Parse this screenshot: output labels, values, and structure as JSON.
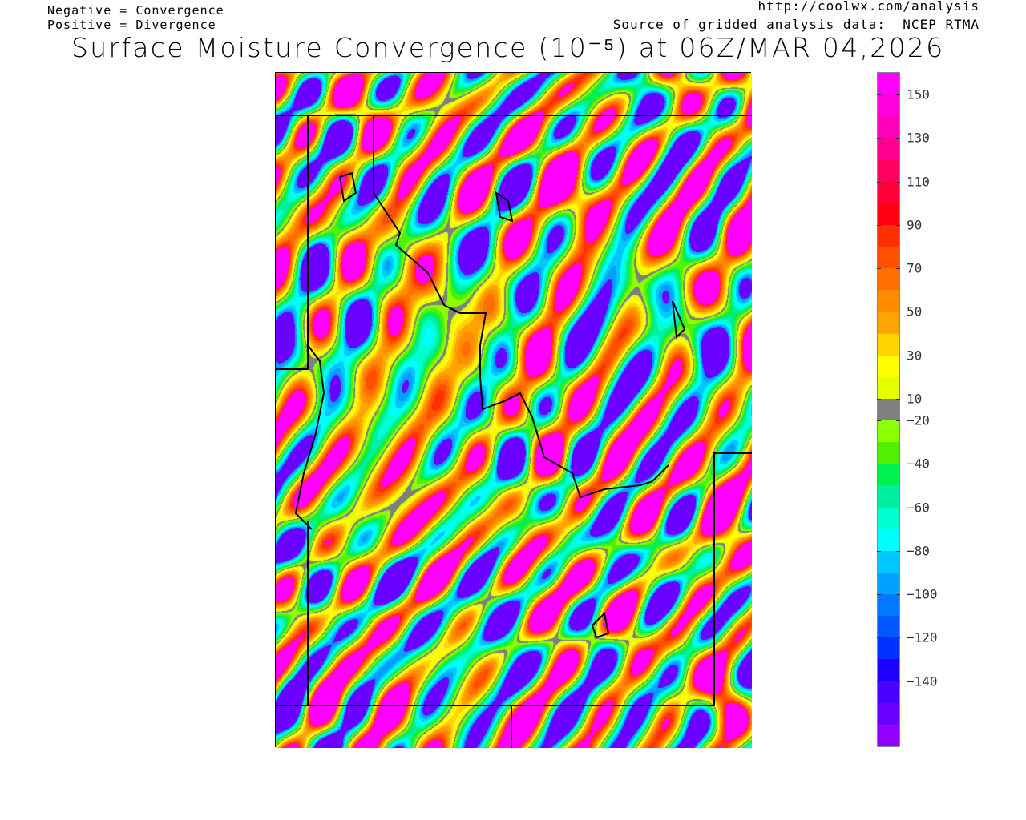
{
  "header": {
    "legend_negative": "Negative = Convergence",
    "legend_positive": "Positive = Divergence",
    "source_url": "http://coolwx.com/analysis",
    "source_data": "Source of gridded analysis data:  NCEP RTMA",
    "title": "Surface Moisture Convergence (10⁻⁵) at 06Z/MAR 04,2026"
  },
  "colorbar": {
    "tick_labels": [
      "150",
      "130",
      "110",
      "90",
      "70",
      "50",
      "30",
      "10",
      "−20",
      "−40",
      "−60",
      "−80",
      "−100",
      "−120",
      "−140"
    ],
    "colors": [
      "#ff00ff",
      "#ff00e0",
      "#ff00b8",
      "#ff0090",
      "#ff0060",
      "#ff0038",
      "#ff0010",
      "#ff3000",
      "#ff5000",
      "#ff7000",
      "#ff8c00",
      "#ffa400",
      "#ffd400",
      "#ffff00",
      "#e6ff00",
      "#7f7f7f",
      "#8cff00",
      "#50f000",
      "#00f050",
      "#00eea0",
      "#00ffd4",
      "#00ffff",
      "#00c8ff",
      "#00a0ff",
      "#0078ff",
      "#0058ff",
      "#0030ff",
      "#2000ff",
      "#4a00ff",
      "#6a00ff",
      "#9000ff"
    ]
  }
}
